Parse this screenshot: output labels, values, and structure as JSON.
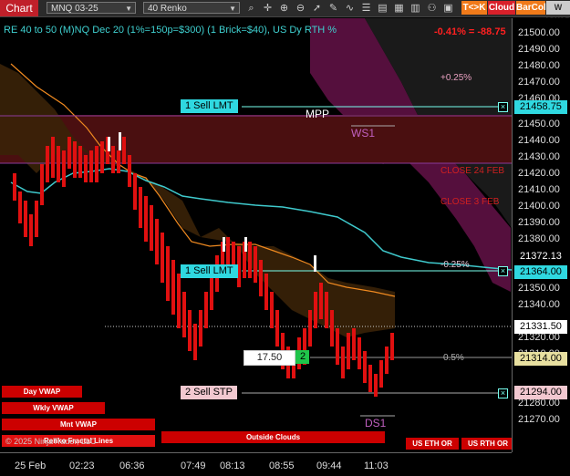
{
  "toolbar": {
    "title": "Chart",
    "instrument": "MNQ 03-25",
    "bar_type": "40 Renko",
    "buttons": {
      "tok": "T<>K",
      "cloud": "Cloud",
      "barcol": "BarCol",
      "ww": "W VWAP"
    },
    "colors": {
      "tok": "#f07a1a",
      "cloud": "#d8202a",
      "barcol": "#f07a1a",
      "ww": "#cccccc"
    }
  },
  "chart": {
    "header": "RE 40 to 50 (M)NQ Dec 20 (1%=150p=$300) (1 Brick=$40), US Dy RTH %",
    "change": "-0.41% = -88.75",
    "labels": {
      "plus025": "+0.25%",
      "mpp": "MPP",
      "ws1": "WS1",
      "close24": "CLOSE 24 FEB",
      "close3": "CLOSE 3 FEB",
      "minus025": "-0.25%",
      "pct05": "0.5%",
      "ds1": "DS1"
    },
    "orders": {
      "sell1": "1 Sell LMT",
      "sell2": "1 Sell LMT",
      "stop": "2 Sell STP",
      "position_price": "17.50",
      "position_qty": "2"
    },
    "bottom_buttons": {
      "day_vwap": "Day VWAP",
      "wkly_vwap": "Wkly VWAP",
      "mnt_vwap": "Mnt VWAP",
      "outside_clouds": "Outside Clouds",
      "us_eth": "US ETH OR",
      "us_rth": "US RTH OR"
    },
    "copyright": "© 2025 NinjaTrader, LLC",
    "overlay_text": "Renko Fractal Lines"
  },
  "yaxis": {
    "ticks": [
      "21500.00",
      "21490.00",
      "21480.00",
      "21470.00",
      "21460.00",
      "21450.00",
      "21440.00",
      "21430.00",
      "21420.00",
      "21410.00",
      "21400.00",
      "21390.00",
      "21380.00",
      "21350.00",
      "21340.00",
      "21320.00",
      "21310.00",
      "21280.00",
      "21270.00"
    ],
    "tags": {
      "t1": "21458.75",
      "t2": "21372.13",
      "t3": "21364.00",
      "t4": "21331.50",
      "t5": "21314.00",
      "t6": "21294.00"
    }
  },
  "xaxis": {
    "ticks": [
      "25 Feb",
      "02:23",
      "06:36",
      "07:49",
      "08:13",
      "08:55",
      "09:44",
      "11:03"
    ]
  }
}
